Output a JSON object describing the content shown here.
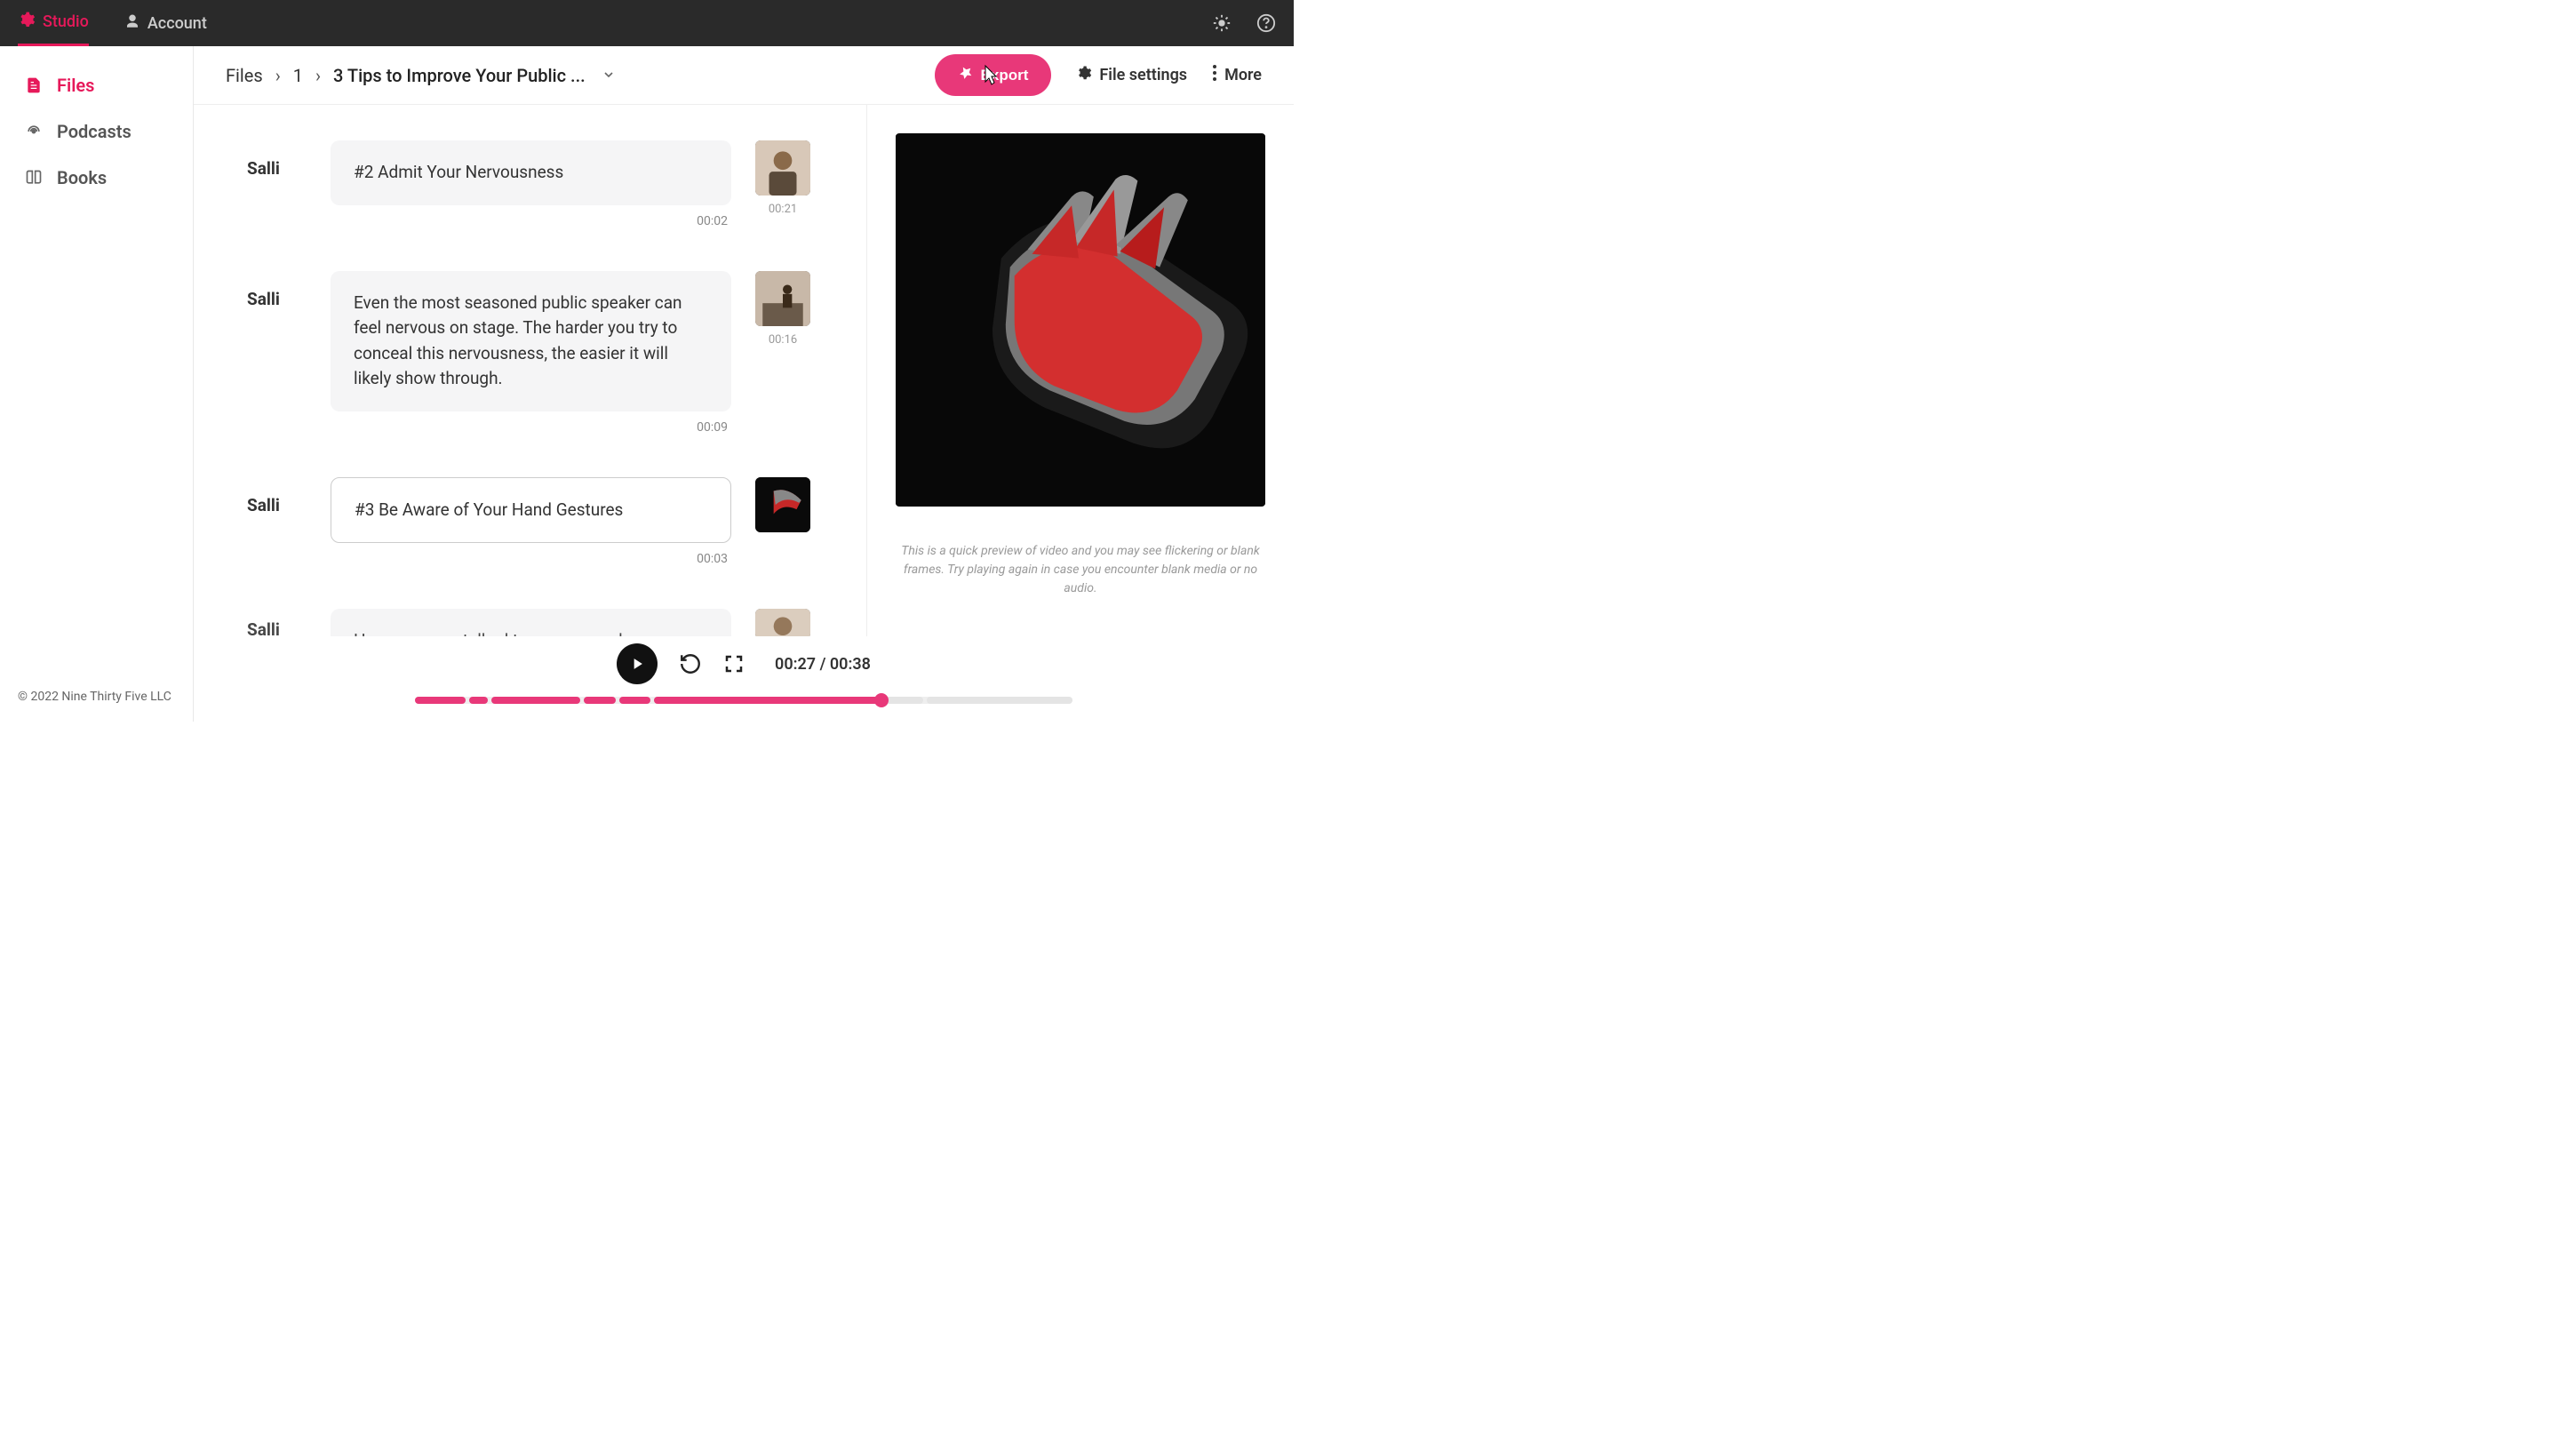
{
  "nav": {
    "studio": "Studio",
    "account": "Account"
  },
  "sidebar": {
    "files": "Files",
    "podcasts": "Podcasts",
    "books": "Books"
  },
  "footer": "© 2022 Nine Thirty Five LLC",
  "breadcrumb": {
    "root": "Files",
    "folder": "1",
    "file": "3 Tips to Improve Your Public ..."
  },
  "actions": {
    "export": "Export",
    "file_settings": "File settings",
    "more": "More"
  },
  "blocks": [
    {
      "speaker": "Salli",
      "text": "#2 Admit Your Nervousness",
      "block_time": "00:02",
      "thumb_time": "00:21",
      "selected": false
    },
    {
      "speaker": "Salli",
      "text": "Even the most seasoned public speaker can feel nervous on stage. The harder you try to conceal this nervousness, the easier it will likely show through.",
      "block_time": "00:09",
      "thumb_time": "00:16",
      "selected": false
    },
    {
      "speaker": "Salli",
      "text": "#3 Be Aware of Your Hand Gestures",
      "block_time": "00:03",
      "thumb_time": "",
      "selected": true
    },
    {
      "speaker": "Salli",
      "text": "Have you ever talked to someone who",
      "block_time": "",
      "thumb_time": "",
      "selected": false
    }
  ],
  "preview": {
    "note": "This is a quick preview of video and you may see flickering or blank frames. Try playing again in case you encounter blank media or no audio."
  },
  "player": {
    "current": "00:27",
    "total": "00:38",
    "progress_percent": 71
  }
}
